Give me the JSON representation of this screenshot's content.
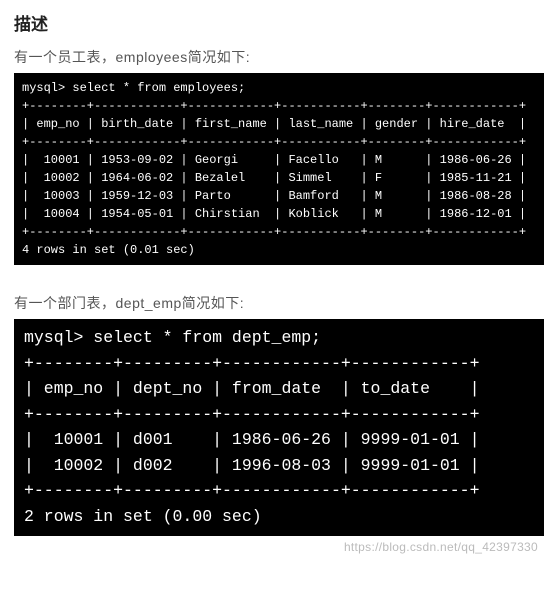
{
  "heading": "描述",
  "section1": {
    "intro": "有一个员工表，employees简况如下:",
    "prompt": "mysql> select * from employees;",
    "table": {
      "columns": [
        "emp_no",
        "birth_date",
        "first_name",
        "last_name",
        "gender",
        "hire_date"
      ],
      "rows": [
        [
          "10001",
          "1953-09-02",
          "Georgi",
          "Facello",
          "M",
          "1986-06-26"
        ],
        [
          "10002",
          "1964-06-02",
          "Bezalel",
          "Simmel",
          "F",
          "1985-11-21"
        ],
        [
          "10003",
          "1959-12-03",
          "Parto",
          "Bamford",
          "M",
          "1986-08-28"
        ],
        [
          "10004",
          "1954-05-01",
          "Chirstian",
          "Koblick",
          "M",
          "1986-12-01"
        ]
      ]
    },
    "footer": "4 rows in set (0.01 sec)"
  },
  "section2": {
    "intro": "有一个部门表，dept_emp简况如下:",
    "prompt": "mysql> select * from dept_emp;",
    "table": {
      "columns": [
        "emp_no",
        "dept_no",
        "from_date",
        "to_date"
      ],
      "rows": [
        [
          "10001",
          "d001",
          "1986-06-26",
          "9999-01-01"
        ],
        [
          "10002",
          "d002",
          "1996-08-03",
          "9999-01-01"
        ]
      ]
    },
    "footer": "2 rows in set (0.00 sec)"
  },
  "watermark": "https://blog.csdn.net/qq_42397330",
  "chart_data": [
    {
      "type": "table",
      "title": "employees",
      "columns": [
        "emp_no",
        "birth_date",
        "first_name",
        "last_name",
        "gender",
        "hire_date"
      ],
      "rows": [
        [
          "10001",
          "1953-09-02",
          "Georgi",
          "Facello",
          "M",
          "1986-06-26"
        ],
        [
          "10002",
          "1964-06-02",
          "Bezalel",
          "Simmel",
          "F",
          "1985-11-21"
        ],
        [
          "10003",
          "1959-12-03",
          "Parto",
          "Bamford",
          "M",
          "1986-08-28"
        ],
        [
          "10004",
          "1954-05-01",
          "Chirstian",
          "Koblick",
          "M",
          "1986-12-01"
        ]
      ]
    },
    {
      "type": "table",
      "title": "dept_emp",
      "columns": [
        "emp_no",
        "dept_no",
        "from_date",
        "to_date"
      ],
      "rows": [
        [
          "10001",
          "d001",
          "1986-06-26",
          "9999-01-01"
        ],
        [
          "10002",
          "d002",
          "1996-08-03",
          "9999-01-01"
        ]
      ]
    }
  ]
}
